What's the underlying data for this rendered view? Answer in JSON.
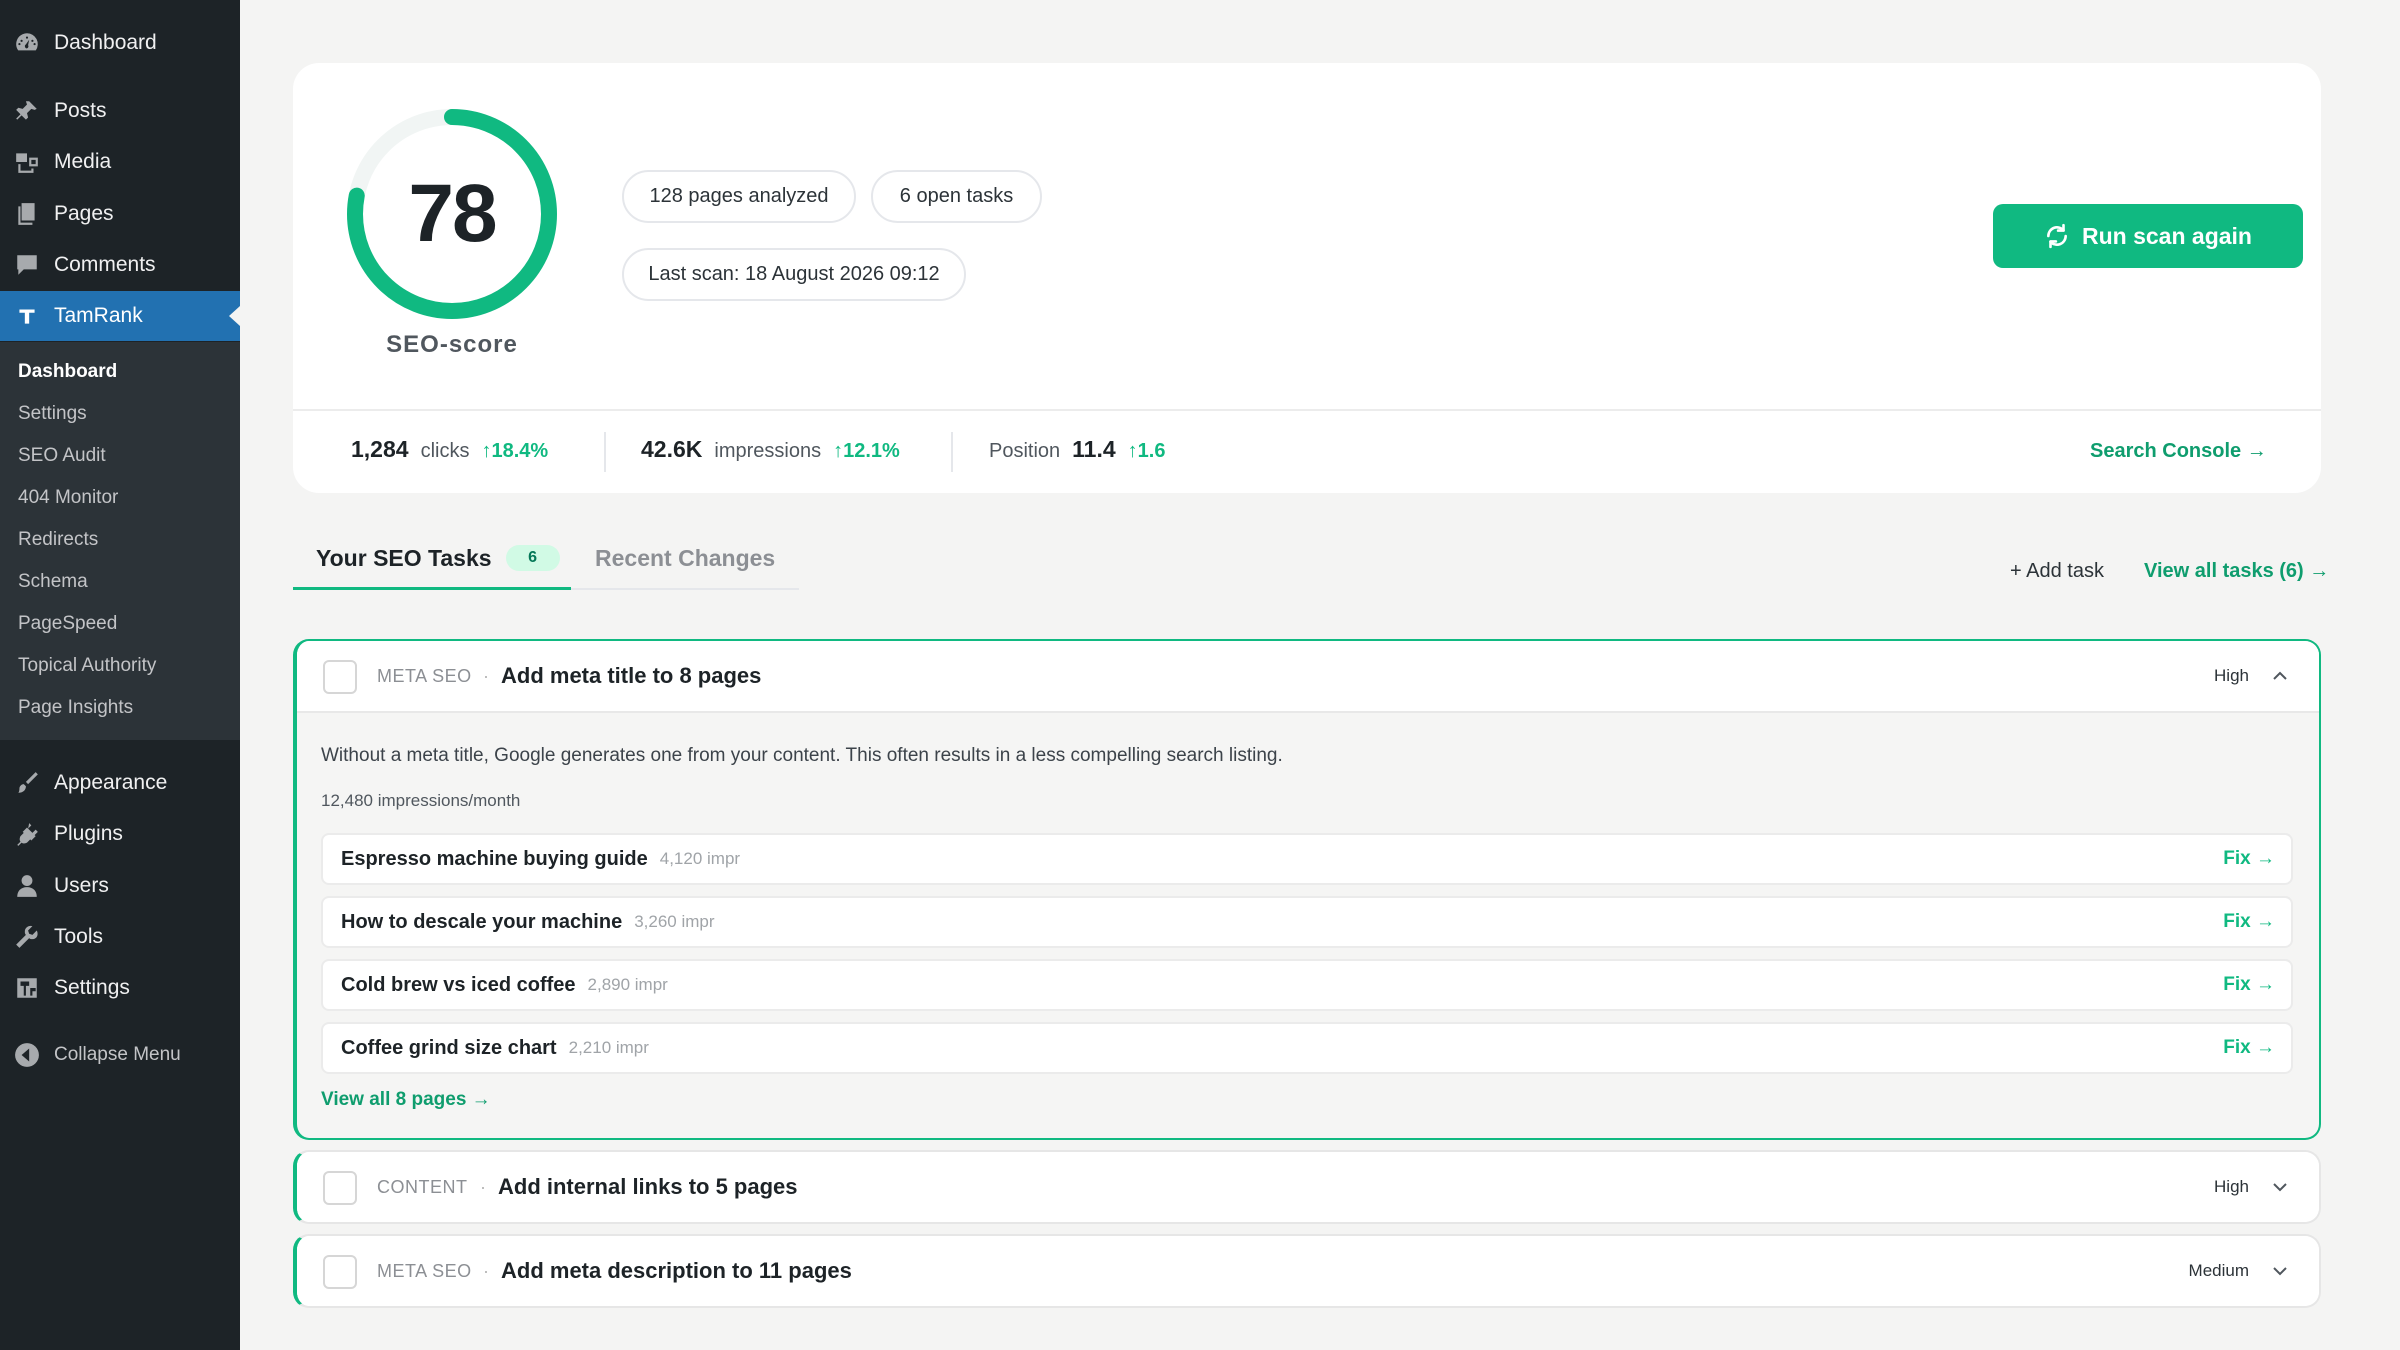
{
  "sidebar": {
    "dashboard": "Dashboard",
    "posts": "Posts",
    "media": "Media",
    "pages": "Pages",
    "comments": "Comments",
    "tamrank": "TamRank",
    "submenu": [
      "Dashboard",
      "Settings",
      "SEO Audit",
      "404 Monitor",
      "Redirects",
      "Schema",
      "PageSpeed",
      "Topical Authority",
      "Page Insights"
    ],
    "appearance": "Appearance",
    "plugins": "Plugins",
    "users": "Users",
    "tools": "Tools",
    "settings": "Settings",
    "collapse": "Collapse Menu"
  },
  "score": {
    "value": "78",
    "percent": 78,
    "label": "SEO-score",
    "pages_analyzed": "128 pages analyzed",
    "open_tasks": "6 open tasks",
    "last_scan": "Last scan: 18 August 2026 09:12",
    "run_button": "Run scan again"
  },
  "stats": {
    "clicks_value": "1,284",
    "clicks_label": "clicks",
    "clicks_delta": "18.4%",
    "impressions_value": "42.6K",
    "impressions_label": "impressions",
    "impressions_delta": "12.1%",
    "position_label": "Position",
    "position_value": "11.4",
    "position_delta": "1.6",
    "console_link": "Search Console →"
  },
  "tabs": {
    "tasks_label": "Your SEO Tasks",
    "tasks_count": "6",
    "changes_label": "Recent Changes",
    "add_task": "+ Add task",
    "view_all_tasks": "View all tasks (6) →"
  },
  "tasks": [
    {
      "category": "META SEO",
      "title": "Add meta title to 8 pages",
      "priority": "High",
      "description": "Without a meta title, Google generates one from your content. This often results in a less compelling search listing.",
      "impressions": "12,480 impressions/month",
      "pages": [
        {
          "title": "Espresso machine buying guide",
          "impr": "4,120 impr",
          "fix": "Fix →"
        },
        {
          "title": "How to descale your machine",
          "impr": "3,260 impr",
          "fix": "Fix →"
        },
        {
          "title": "Cold brew vs iced coffee",
          "impr": "2,890 impr",
          "fix": "Fix →"
        },
        {
          "title": "Coffee grind size chart",
          "impr": "2,210 impr",
          "fix": "Fix →"
        }
      ],
      "view_all": "View all 8 pages →"
    },
    {
      "category": "CONTENT",
      "title": "Add internal links to 5 pages",
      "priority": "High"
    },
    {
      "category": "META SEO",
      "title": "Add meta description to 11 pages",
      "priority": "Medium"
    }
  ],
  "colors": {
    "accent": "#10b981",
    "sidebar_bg": "#1d2327",
    "active_menu": "#2271b1"
  }
}
